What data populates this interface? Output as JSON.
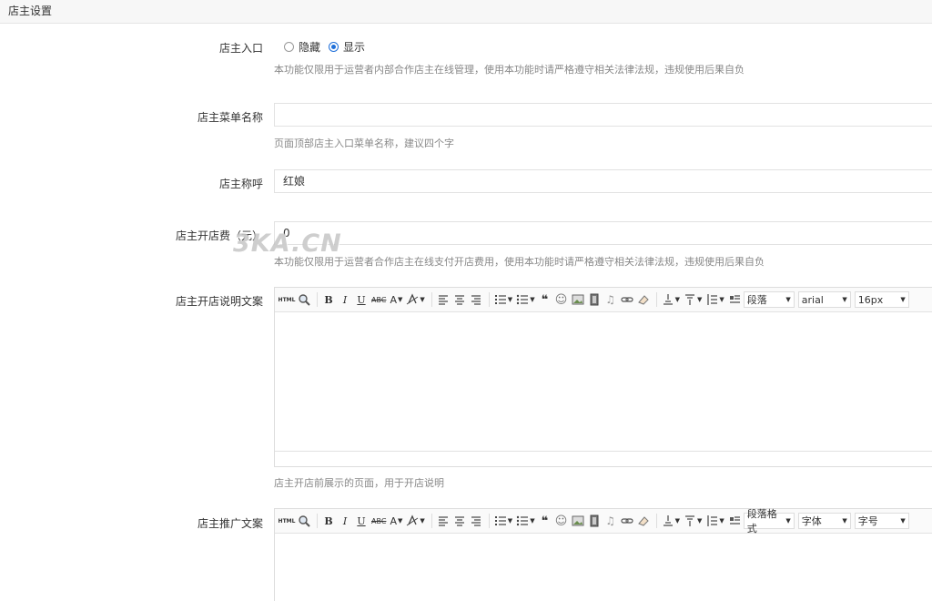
{
  "header": {
    "title": "店主设置"
  },
  "shop_entry": {
    "label": "店主入口",
    "options": [
      {
        "label": "隐藏",
        "checked": false
      },
      {
        "label": "显示",
        "checked": true
      }
    ],
    "help": "本功能仅限用于运营者内部合作店主在线管理，使用本功能时请严格遵守相关法律法规，违规使用后果自负"
  },
  "menu_name": {
    "label": "店主菜单名称",
    "value": "",
    "help": "页面顶部店主入口菜单名称，建议四个字"
  },
  "title_name": {
    "label": "店主称呼",
    "value": "红娘"
  },
  "open_fee": {
    "label": "店主开店费（元）",
    "value": "0",
    "help": "本功能仅限用于运营者合作店主在线支付开店费用，使用本功能时请严格遵守相关法律法规，违规使用后果自负"
  },
  "open_desc": {
    "label": "店主开店说明文案",
    "selects": {
      "paragraph": "段落",
      "font": "arial",
      "size": "16px"
    },
    "help": "店主开店前展示的页面，用于开店说明"
  },
  "promo": {
    "label": "店主推广文案",
    "selects": {
      "paragraph": "段落格式",
      "font": "字体",
      "size": "字号"
    }
  },
  "toolbar": {
    "html": "HTML",
    "bold": "B",
    "italic": "I",
    "underline": "U",
    "strike": "ABC",
    "fontcolor": "A",
    "quote": "❝",
    "emotion": "☺"
  },
  "watermark": "3KA.CN"
}
